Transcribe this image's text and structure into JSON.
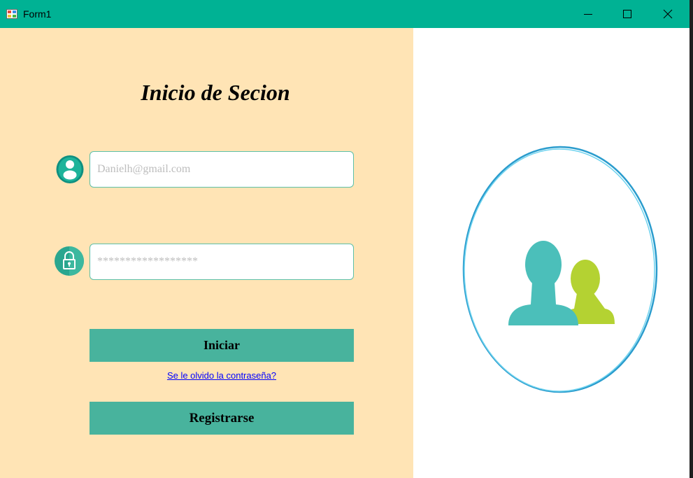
{
  "window": {
    "title": "Form1",
    "icon": "windows-forms-icon",
    "controls": [
      "minimize-icon",
      "maximize-icon",
      "close-icon"
    ],
    "titlebar_color": "#00b294"
  },
  "login": {
    "heading": "Inicio de Secion",
    "email_placeholder": "Danielh@gmail.com",
    "password_placeholder": "******************",
    "login_button": "Iniciar",
    "forgot_link": "Se le olvido la contraseña?",
    "register_button": "Registrarse",
    "panel_color": "#ffe4b5",
    "button_color": "#48b39d",
    "icons": [
      "user-icon",
      "lock-icon"
    ]
  },
  "illustration": {
    "icon": "users-group-icon",
    "colors": {
      "front_person": "#4bbfba",
      "back_person": "#b4d232",
      "ring": "#2fa8d8"
    }
  }
}
